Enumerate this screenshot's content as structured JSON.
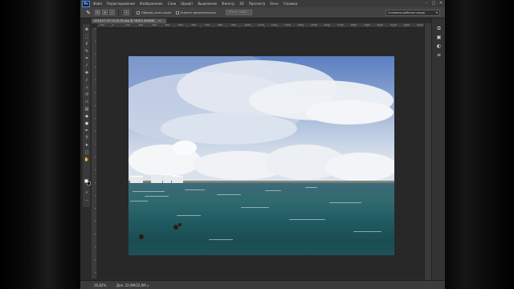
{
  "menu": {
    "logo": "Ps",
    "items": [
      "Файл",
      "Редактирование",
      "Изображение",
      "Слои",
      "Шрифт",
      "Выделение",
      "Фильтр",
      "3D",
      "Просмотр",
      "Окно",
      "Справка"
    ],
    "window_controls": [
      "–",
      "□",
      "✕"
    ]
  },
  "options_bar": {
    "tool_icon": "quick-selection-icon",
    "sample_all_label": "Образец всех слоев",
    "auto_enhance_label": "Усилить автоматически",
    "refine_edge_button": "Уточн. край...",
    "workspace": "Основная рабочая среда"
  },
  "document": {
    "tab_title": "2016-07-19 15-42-52.jpg @ 26,8% (RGB/8)",
    "tab_close": "×"
  },
  "ruler": {
    "ticks": [
      "-100",
      "0",
      "100",
      "200",
      "300",
      "400",
      "500",
      "600",
      "700",
      "800",
      "900",
      "1000",
      "1100",
      "1200",
      "1300",
      "1400",
      "1500",
      "1600",
      "1700",
      "1800",
      "1900",
      "2000",
      "2100",
      "2200",
      "2300"
    ]
  },
  "tools": [
    {
      "name": "move-tool-icon",
      "glyph": "✥"
    },
    {
      "name": "marquee-tool-icon",
      "glyph": "⬚"
    },
    {
      "name": "lasso-tool-icon",
      "glyph": "ℓ"
    },
    {
      "name": "quick-selection-tool-icon",
      "glyph": "✎"
    },
    {
      "name": "crop-tool-icon",
      "glyph": "⌗"
    },
    {
      "name": "eyedropper-tool-icon",
      "glyph": "⁄"
    },
    {
      "name": "healing-brush-tool-icon",
      "glyph": "✚"
    },
    {
      "name": "brush-tool-icon",
      "glyph": "∕"
    },
    {
      "name": "clone-stamp-tool-icon",
      "glyph": "⊥"
    },
    {
      "name": "history-brush-tool-icon",
      "glyph": "↺"
    },
    {
      "name": "eraser-tool-icon",
      "glyph": "▭"
    },
    {
      "name": "gradient-tool-icon",
      "glyph": "▤"
    },
    {
      "name": "blur-tool-icon",
      "glyph": "◆"
    },
    {
      "name": "dodge-tool-icon",
      "glyph": "●"
    },
    {
      "name": "pen-tool-icon",
      "glyph": "✒"
    },
    {
      "name": "type-tool-icon",
      "glyph": "T"
    },
    {
      "name": "path-selection-tool-icon",
      "glyph": "➤"
    },
    {
      "name": "shape-tool-icon",
      "glyph": "▢"
    },
    {
      "name": "hand-tool-icon",
      "glyph": "✋"
    },
    {
      "name": "zoom-tool-icon",
      "glyph": "⌕"
    },
    {
      "name": "more-tools-icon",
      "glyph": "…"
    }
  ],
  "status_bar": {
    "zoom": "26,82%",
    "doc_info": "Док: 22,9M/22,9M",
    "arrow": "▸"
  },
  "panels": [
    {
      "name": "history-panel-icon",
      "glyph": "⧉"
    },
    {
      "name": "properties-panel-icon",
      "glyph": "▣"
    },
    {
      "name": "color-panel-icon",
      "glyph": "◐"
    },
    {
      "name": "layers-panel-icon",
      "glyph": "≡"
    }
  ]
}
